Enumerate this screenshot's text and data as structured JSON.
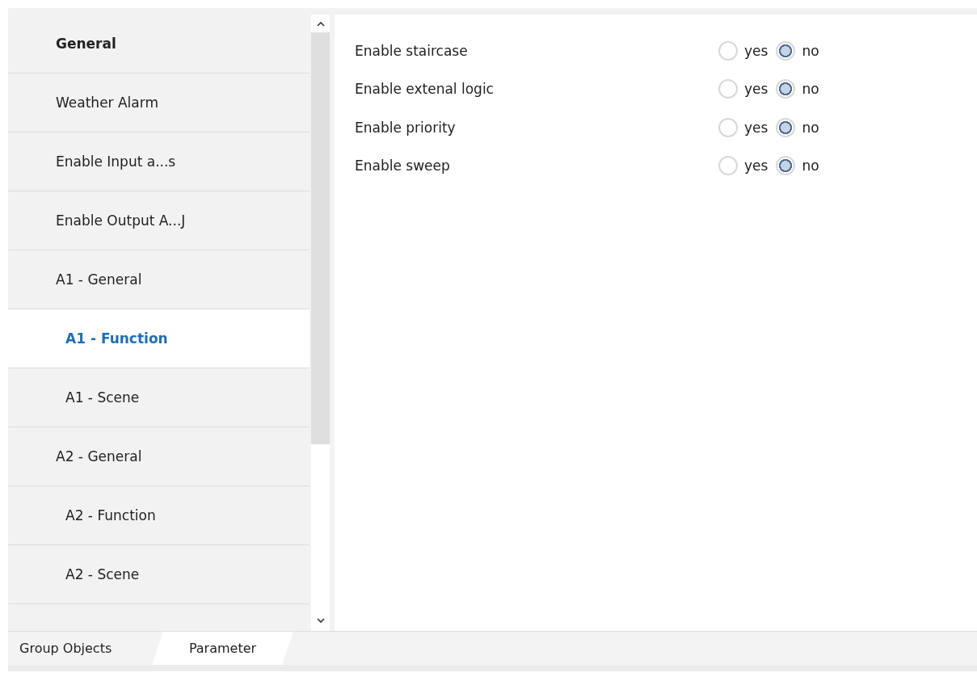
{
  "sidebar": {
    "items": [
      {
        "label": "General",
        "bold": true,
        "selected": false
      },
      {
        "label": "Weather Alarm",
        "bold": false,
        "selected": false
      },
      {
        "label": "Enable Input a...s",
        "bold": false,
        "selected": false
      },
      {
        "label": "Enable Output A...J",
        "bold": false,
        "selected": false
      },
      {
        "label": "A1 - General",
        "bold": false,
        "selected": false,
        "children": [
          {
            "label": "A1 - Function",
            "bold": false,
            "selected": true
          },
          {
            "label": "A1 - Scene",
            "bold": false,
            "selected": false
          }
        ]
      },
      {
        "label": "A2 - General",
        "bold": false,
        "selected": false,
        "children": [
          {
            "label": "A2 - Function",
            "bold": false,
            "selected": false
          },
          {
            "label": "A2 - Scene",
            "bold": false,
            "selected": false
          }
        ]
      }
    ]
  },
  "parameters": [
    {
      "label": "Enable staircase",
      "options": [
        {
          "label": "yes",
          "selected": false
        },
        {
          "label": "no",
          "selected": true
        }
      ]
    },
    {
      "label": "Enable extenal logic",
      "options": [
        {
          "label": "yes",
          "selected": false
        },
        {
          "label": "no",
          "selected": true
        }
      ]
    },
    {
      "label": "Enable priority",
      "options": [
        {
          "label": "yes",
          "selected": false
        },
        {
          "label": "no",
          "selected": true
        }
      ]
    },
    {
      "label": "Enable sweep",
      "options": [
        {
          "label": "yes",
          "selected": false
        },
        {
          "label": "no",
          "selected": true
        }
      ]
    }
  ],
  "tabs": [
    {
      "label": "Group Objects",
      "selected": false
    },
    {
      "label": "Parameter",
      "selected": true
    }
  ]
}
